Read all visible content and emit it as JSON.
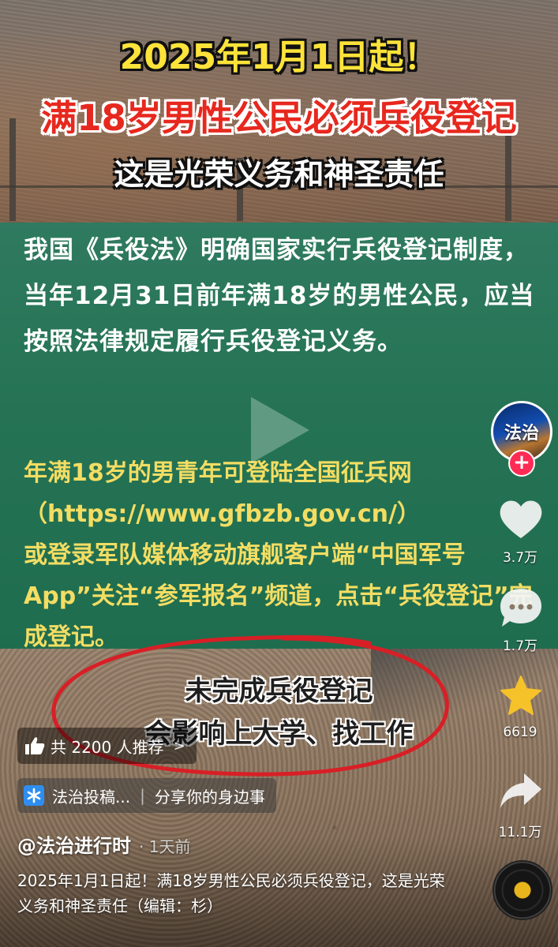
{
  "headline": {
    "line1": "2025年1月1日起！",
    "line2": "满18岁男性公民必须兵役登记",
    "line3": "这是光荣义务和神圣责任"
  },
  "panel": {
    "paragraph1": "我国《兵役法》明确国家实行兵役登记制度，当年12月31日前年满18岁的男性公民，应当按照法律规定履行兵役登记义务。",
    "paragraph2_a": "年满18岁的男青年可登陆全国征兵网",
    "paragraph2_url": "（https://www.gfbzb.gov.cn/）",
    "paragraph2_b": "或登录军队媒体移动旗舰客户端“中国军号App”关注“参军报名”频道，点击“兵役登记”完成登记。"
  },
  "subtitle": {
    "line1": "未完成兵役登记",
    "line2": "会影响上大学、找工作"
  },
  "sidebar": {
    "avatar_text": "法治",
    "follow_label": "+",
    "likes": "3.7万",
    "comments": "1.7万",
    "favorites": "6619",
    "shares": "11.1万"
  },
  "recommend": {
    "text": "共 2200 人推荐",
    "arrow": ">"
  },
  "tag": {
    "label": "法治投稿...",
    "topic": "分享你的身边事"
  },
  "author": {
    "name": "@法治进行时",
    "time": "· 1天前"
  },
  "caption": "2025年1月1日起！满18岁男性公民必须兵役登记，这是光荣义务和神圣责任（编辑：杉）",
  "colors": {
    "headline_yellow": "#fde33a",
    "headline_red": "#e7281e",
    "panel_green": "#257354",
    "panel_yellow_text": "#f3dd63",
    "circle_red": "#d81f26",
    "follow_pink": "#ff2b55",
    "star_yellow": "#f6c22a"
  }
}
